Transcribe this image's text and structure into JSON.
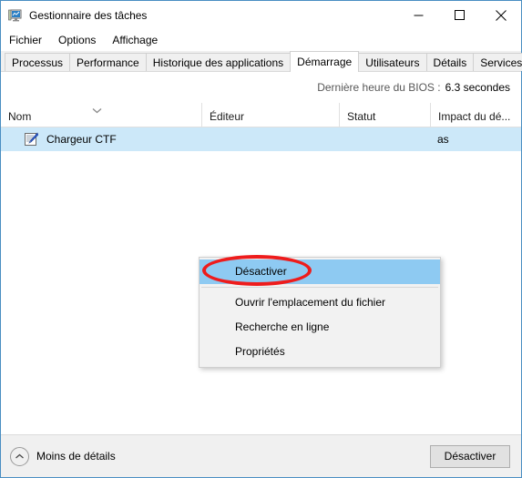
{
  "window": {
    "title": "Gestionnaire des tâches",
    "icon": "task-manager-icon",
    "controls": {
      "minimize": "minimize-icon",
      "maximize": "maximize-icon",
      "close": "close-icon"
    }
  },
  "menubar": {
    "items": [
      {
        "label": "Fichier"
      },
      {
        "label": "Options"
      },
      {
        "label": "Affichage"
      }
    ]
  },
  "tabs": [
    {
      "label": "Processus",
      "active": false
    },
    {
      "label": "Performance",
      "active": false
    },
    {
      "label": "Historique des applications",
      "active": false
    },
    {
      "label": "Démarrage",
      "active": true
    },
    {
      "label": "Utilisateurs",
      "active": false
    },
    {
      "label": "Détails",
      "active": false
    },
    {
      "label": "Services",
      "active": false
    }
  ],
  "bios": {
    "label": "Dernière heure du BIOS :",
    "value": "6.3 secondes"
  },
  "list": {
    "columns": [
      {
        "label": "Nom",
        "sorted": true,
        "sort_icon": "chevron-down-icon"
      },
      {
        "label": "Éditeur"
      },
      {
        "label": "Statut"
      },
      {
        "label": "Impact du dé..."
      }
    ],
    "rows": [
      {
        "icon": "ctf-loader-icon",
        "name": "Chargeur CTF",
        "editeur": "",
        "statut": "",
        "impact": "as"
      }
    ]
  },
  "context_menu": {
    "items": [
      {
        "label": "Désactiver",
        "highlighted": true
      },
      {
        "separator": true
      },
      {
        "label": "Ouvrir l'emplacement du fichier",
        "highlighted": false
      },
      {
        "label": "Recherche en ligne",
        "highlighted": false
      },
      {
        "label": "Propriétés",
        "highlighted": false
      }
    ]
  },
  "annotation": {
    "shape": "red-ellipse",
    "color": "#ee1c1c",
    "targets": "Désactiver"
  },
  "footer": {
    "less_details_label": "Moins de détails",
    "less_details_icon": "chevron-up-circle-icon",
    "action_button": "Désactiver"
  },
  "colors": {
    "window_border": "#4a8ec2",
    "selection_row": "#cce8f9",
    "menu_highlight": "#8ecaf2",
    "annotation_red": "#ee1c1c",
    "chrome_gray": "#f0f0f0"
  }
}
